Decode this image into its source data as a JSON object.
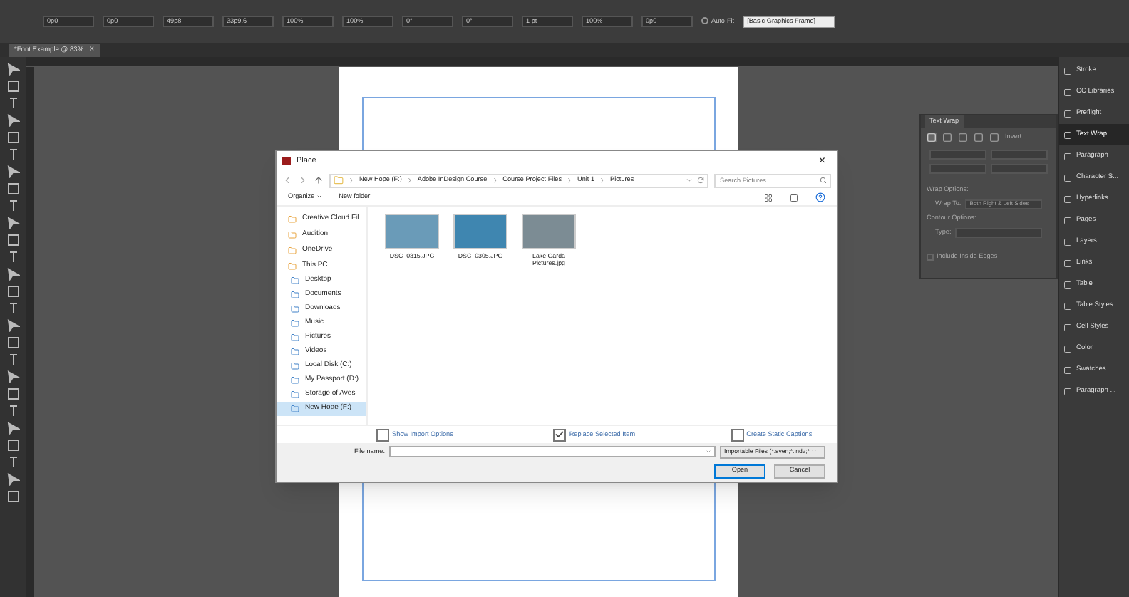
{
  "control_bar": {
    "fields": [
      "0p0",
      "0p0",
      "49p8",
      "33p9.6",
      "100%",
      "100%",
      "0°",
      "0°",
      "1 pt",
      "100%",
      "0p0"
    ],
    "auto_fit": {
      "label": "Auto-Fit",
      "checked": false
    },
    "style_field": "[Basic Graphics Frame]"
  },
  "document_tab": {
    "title": "*Font Example @ 83%",
    "close": "×"
  },
  "text_wrap_panel": {
    "title": "Text Wrap",
    "invert": "Invert",
    "wrap_options": "Wrap Options:",
    "wrap_to_label": "Wrap To:",
    "wrap_to_value": "Both Right & Left Sides",
    "contour_options": "Contour Options:",
    "type_label": "Type:",
    "include_inside_edges": {
      "label": "Include Inside Edges",
      "checked": false
    },
    "disabled": true
  },
  "panel_dock": [
    {
      "label": "Stroke",
      "selected": false
    },
    {
      "label": "CC Libraries",
      "selected": false
    },
    {
      "label": "Preflight",
      "selected": false
    },
    {
      "label": "Text Wrap",
      "selected": true
    },
    {
      "label": "Paragraph",
      "selected": false
    },
    {
      "label": "Character S...",
      "selected": false
    },
    {
      "label": "Hyperlinks",
      "selected": false
    },
    {
      "label": "Pages",
      "selected": false
    },
    {
      "label": "Layers",
      "selected": false
    },
    {
      "label": "Links",
      "selected": false
    },
    {
      "label": "Table",
      "selected": false
    },
    {
      "label": "Table Styles",
      "selected": false
    },
    {
      "label": "Cell Styles",
      "selected": false
    },
    {
      "label": "Color",
      "selected": false
    },
    {
      "label": "Swatches",
      "selected": false
    },
    {
      "label": "Paragraph ...",
      "selected": false
    }
  ],
  "dialog": {
    "title": "Place",
    "close": "×",
    "breadcrumbs": [
      "New Hope (F:)",
      "Adobe InDesign Course",
      "Course Project Files",
      "Unit 1",
      "Pictures"
    ],
    "search": {
      "placeholder": "Search Pictures"
    },
    "toolbar": {
      "organize": "Organize",
      "new_folder": "New folder"
    },
    "sidebar": [
      {
        "label": "Creative Cloud Fil",
        "selected": false
      },
      {
        "label": "Audition",
        "selected": false
      },
      {
        "label": "OneDrive",
        "selected": false
      },
      {
        "label": "This PC",
        "selected": false,
        "children": [
          {
            "label": "Desktop",
            "selected": false
          },
          {
            "label": "Documents",
            "selected": false
          },
          {
            "label": "Downloads",
            "selected": false
          },
          {
            "label": "Music",
            "selected": false
          },
          {
            "label": "Pictures",
            "selected": false
          },
          {
            "label": "Videos",
            "selected": false
          },
          {
            "label": "Local Disk (C:)",
            "selected": false
          },
          {
            "label": "My Passport (D:)",
            "selected": false
          },
          {
            "label": "Storage of Aves",
            "selected": false
          },
          {
            "label": "New Hope (F:)",
            "selected": true
          }
        ]
      }
    ],
    "files": [
      {
        "name": "DSC_0315.JPG",
        "selected": false
      },
      {
        "name": "DSC_0305.JPG",
        "selected": false
      },
      {
        "name": "Lake Garda Pictures.jpg",
        "selected": false
      }
    ],
    "options": [
      {
        "label": "Show Import Options",
        "checked": false
      },
      {
        "label": "Replace Selected Item",
        "checked": true
      },
      {
        "label": "Create Static Captions",
        "checked": false
      }
    ],
    "file_name": {
      "label": "File name:"
    },
    "file_type": "Importable Files (*.sven;*.indv;*",
    "buttons": [
      {
        "label": "Open",
        "kind": "primary"
      },
      {
        "label": "Cancel",
        "kind": "secondary"
      }
    ]
  }
}
